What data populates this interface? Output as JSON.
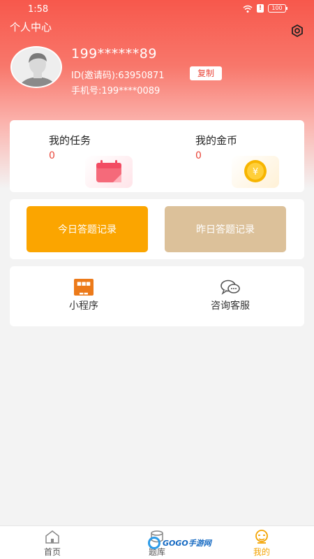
{
  "status": {
    "time": "1:58",
    "battery": "100"
  },
  "header": {
    "title": "个人中心"
  },
  "profile": {
    "username": "199******89",
    "id_line": "ID(邀请码):63950871",
    "copy_label": "复制",
    "phone_line": "手机号:199****0089"
  },
  "stats": {
    "tasks": {
      "label": "我的任务",
      "value": "0"
    },
    "coins": {
      "label": "我的金币",
      "value": "0"
    }
  },
  "records": {
    "today": "今日答题记录",
    "yesterday": "昨日答题记录"
  },
  "services": {
    "miniprogram": {
      "label": "小程序"
    },
    "consult": {
      "label": "咨询客服"
    }
  },
  "tabs": [
    {
      "label": "首页",
      "icon": "home-icon"
    },
    {
      "label": "题库",
      "icon": "question-bank-icon"
    },
    {
      "label": "我的",
      "icon": "profile-icon"
    }
  ],
  "watermark": {
    "text": "GOGO手游网"
  },
  "colors": {
    "header": "#f7584c",
    "today_button": "#fba500",
    "yesterday_button": "#dcc19a",
    "active_tab": "#f3a300",
    "value_red": "#e9463a"
  }
}
